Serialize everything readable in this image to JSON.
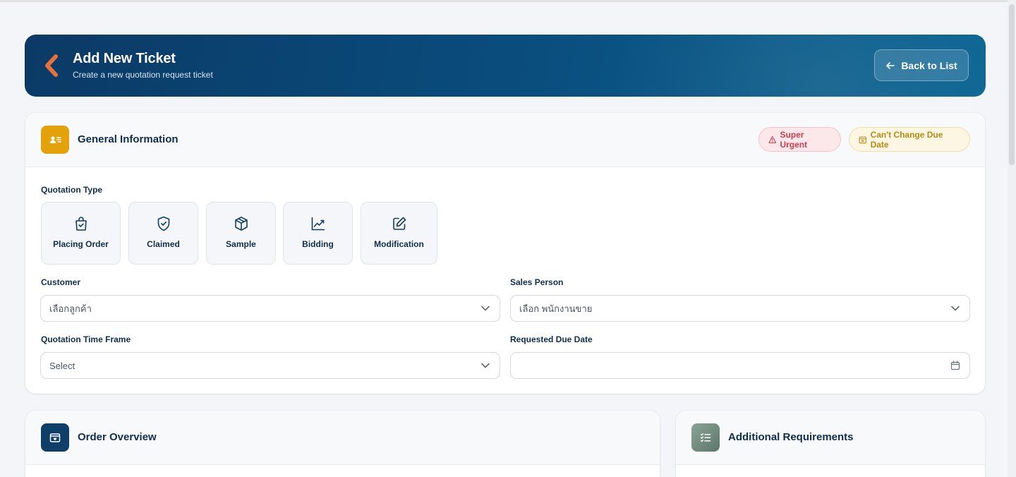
{
  "header": {
    "title": "Add New Ticket",
    "subtitle": "Create a new quotation request ticket",
    "back_label": "Back to List"
  },
  "general": {
    "title": "General Information",
    "badges": {
      "super_urgent": "Super Urgent",
      "cant_change_due": "Can't Change Due Date"
    },
    "quotation_type_label": "Quotation Type",
    "quotation_types": [
      {
        "label": "Placing Order",
        "icon": "shopping-bag-check-icon"
      },
      {
        "label": "Claimed",
        "icon": "shield-check-icon"
      },
      {
        "label": "Sample",
        "icon": "box-icon"
      },
      {
        "label": "Bidding",
        "icon": "trending-chart-icon"
      },
      {
        "label": "Modification",
        "icon": "edit-icon"
      }
    ],
    "customer": {
      "label": "Customer",
      "placeholder": "เลือกลูกค้า"
    },
    "sales_person": {
      "label": "Sales Person",
      "placeholder": "เลือก พนักงานขาย"
    },
    "time_frame": {
      "label": "Quotation Time Frame",
      "placeholder": "Select"
    },
    "due_date": {
      "label": "Requested Due Date",
      "value": ""
    }
  },
  "order_overview": {
    "title": "Order Overview"
  },
  "additional_requirements": {
    "title": "Additional Requirements"
  },
  "colors": {
    "banner_start": "#0b3a66",
    "banner_end": "#0b6593",
    "accent_orange": "#e8703a",
    "general_icon": "#e3a20a",
    "overview_icon": "#0f3e68",
    "additional_icon": "#6f8a80",
    "urgent": "#cc3d4f",
    "due_date_badge": "#b98a12"
  }
}
